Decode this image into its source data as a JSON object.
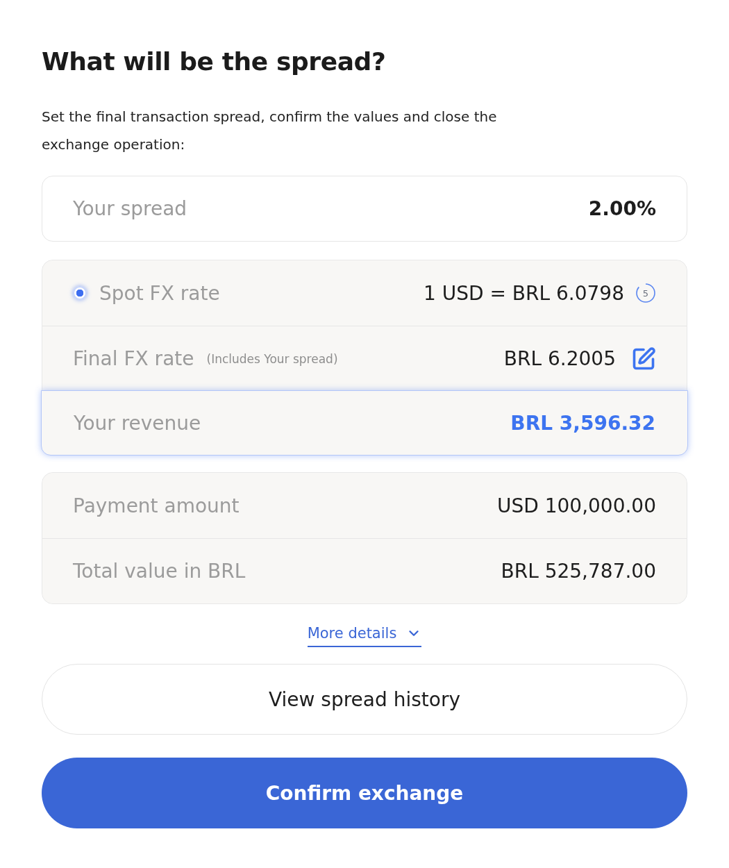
{
  "heading": "What will be the spread?",
  "intro": "Set the final transaction spread, confirm the values and close the exchange operation:",
  "spread_field": {
    "label": "Your spread",
    "value": "2.00%"
  },
  "rate_card": {
    "spot": {
      "label": "Spot FX rate",
      "value": "1 USD = BRL 6.0798",
      "countdown": "5",
      "selected": true
    },
    "final": {
      "label": "Final FX rate",
      "note": "(Includes Your spread)",
      "value": "BRL 6.2005"
    },
    "revenue": {
      "label": "Your revenue",
      "value": "BRL 3,596.32",
      "focused": true
    }
  },
  "summary_card": {
    "rows": [
      {
        "label": "Payment amount",
        "value": "USD 100,000.00"
      },
      {
        "label": "Total value in BRL",
        "value": "BRL 525,787.00"
      }
    ]
  },
  "more_details": {
    "label": "More details",
    "expanded": false
  },
  "buttons": [
    {
      "kind": "secondary",
      "label": "View spread history"
    },
    {
      "kind": "primary",
      "label": "Confirm exchange"
    }
  ]
}
